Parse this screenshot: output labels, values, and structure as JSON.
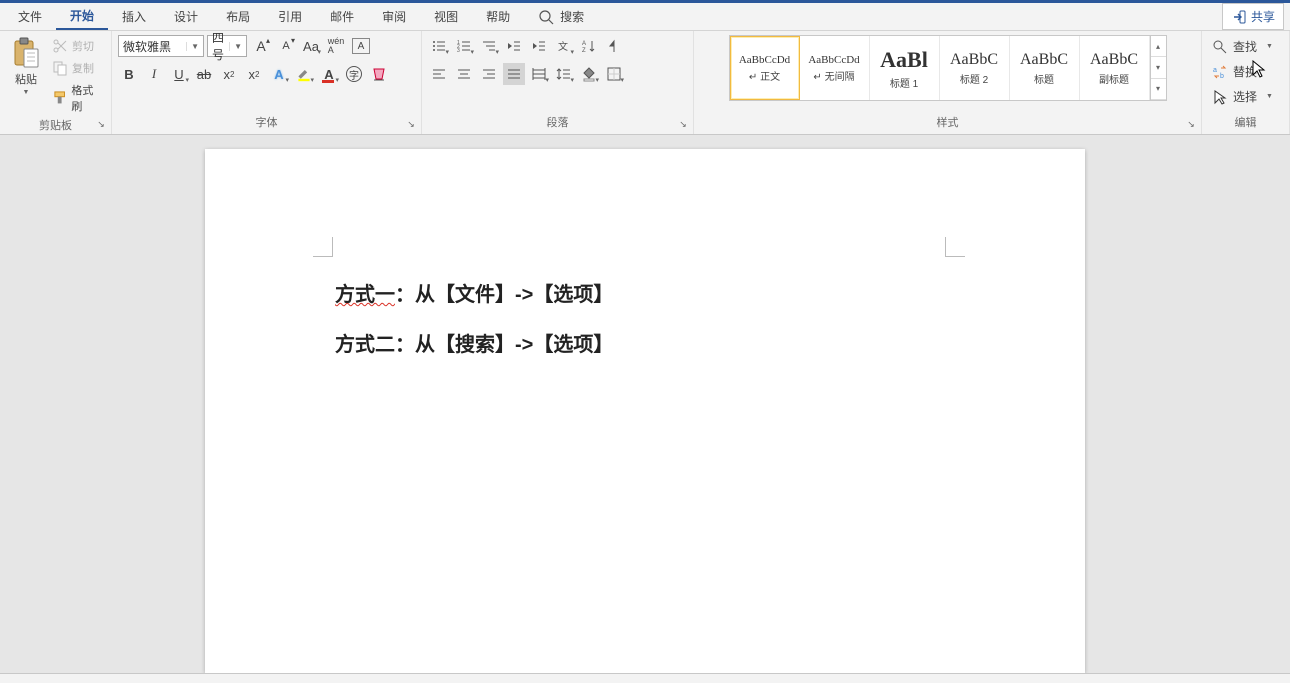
{
  "titlebar": {
    "share": "共享"
  },
  "tabs": {
    "file": "文件",
    "home": "开始",
    "insert": "插入",
    "design": "设计",
    "layout": "布局",
    "references": "引用",
    "mailings": "邮件",
    "review": "审阅",
    "view": "视图",
    "help": "帮助",
    "search": "搜索"
  },
  "ribbon": {
    "clipboard": {
      "label": "剪贴板",
      "paste": "粘贴",
      "cut": "剪切",
      "copy": "复制",
      "format_painter": "格式刷"
    },
    "font": {
      "label": "字体",
      "name": "微软雅黑",
      "size": "四号"
    },
    "paragraph": {
      "label": "段落"
    },
    "styles": {
      "label": "样式",
      "items": [
        {
          "preview": "AaBbCcDd",
          "name": "正文",
          "size": "11px",
          "prefix": "↵ "
        },
        {
          "preview": "AaBbCcDd",
          "name": "无间隔",
          "size": "11px",
          "prefix": "↵ "
        },
        {
          "preview": "AaBl",
          "name": "标题 1",
          "size": "20px",
          "weight": "700"
        },
        {
          "preview": "AaBbC",
          "name": "标题 2",
          "size": "15px"
        },
        {
          "preview": "AaBbC",
          "name": "标题",
          "size": "15px"
        },
        {
          "preview": "AaBbC",
          "name": "副标题",
          "size": "15px"
        }
      ]
    },
    "editing": {
      "label": "编辑",
      "find": "查找",
      "replace": "替换",
      "select": "选择"
    }
  },
  "document": {
    "line1_a": "方式一",
    "line1_b": "：从【文件】->【选项】",
    "line2": "方式二：从【搜索】->【选项】"
  }
}
